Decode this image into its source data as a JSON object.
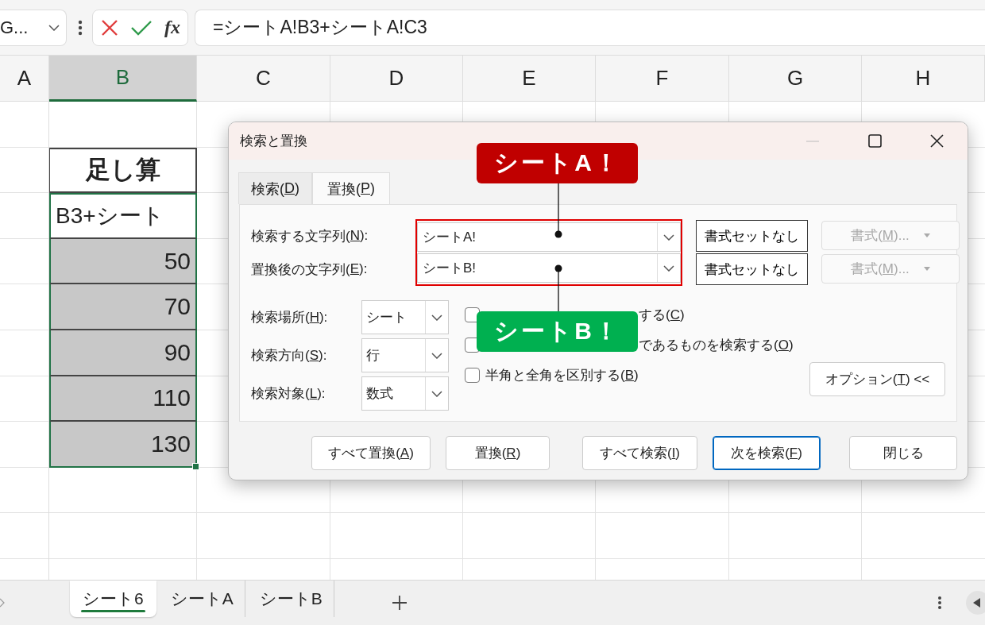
{
  "formula_bar": {
    "name_box": "G...",
    "function_label": "fx",
    "formula": "=シートA!B3+シートA!C3"
  },
  "sheet": {
    "columns": [
      {
        "label": "A",
        "selected": false
      },
      {
        "label": "B",
        "selected": true
      },
      {
        "label": "C",
        "selected": false
      },
      {
        "label": "D",
        "selected": false
      },
      {
        "label": "E",
        "selected": false
      },
      {
        "label": "F",
        "selected": false
      },
      {
        "label": "G",
        "selected": false
      },
      {
        "label": "H",
        "selected": false
      }
    ],
    "column_b_cells": [
      {
        "text": "足し算",
        "kind": "heading",
        "shaded": false,
        "selected": false
      },
      {
        "text": "B3+シート",
        "kind": "text",
        "shaded": false,
        "selected": true
      },
      {
        "text": "50",
        "kind": "number",
        "shaded": true,
        "selected": true
      },
      {
        "text": "70",
        "kind": "number",
        "shaded": true,
        "selected": true
      },
      {
        "text": "90",
        "kind": "number",
        "shaded": true,
        "selected": true
      },
      {
        "text": "110",
        "kind": "number",
        "shaded": true,
        "selected": true
      },
      {
        "text": "130",
        "kind": "number",
        "shaded": true,
        "selected": true
      }
    ]
  },
  "dialog": {
    "title": "検索と置換",
    "tabs": [
      {
        "label": {
          "pre": "検索(",
          "key": "D",
          "post": ")"
        },
        "selected": false
      },
      {
        "label": {
          "pre": "置換(",
          "key": "P",
          "post": ")"
        },
        "selected": true
      }
    ],
    "fields": [
      {
        "label": {
          "pre": "検索する文字列(",
          "key": "N",
          "post": "):"
        },
        "value": "シートA!",
        "format_reset": "書式セットなし",
        "format": {
          "label": {
            "pre": "書式(",
            "key": "M",
            "post": ")..."
          },
          "disabled": true
        }
      },
      {
        "label": {
          "pre": "置換後の文字列(",
          "key": "E",
          "post": "):"
        },
        "value": "シートB!",
        "format_reset": "書式セットなし",
        "format": {
          "label": {
            "pre": "書式(",
            "key": "M",
            "post": ")..."
          },
          "disabled": true
        }
      }
    ],
    "options": [
      {
        "label": {
          "pre": "検索場所(",
          "key": "H",
          "post": "):"
        },
        "value": "シート"
      },
      {
        "label": {
          "pre": "検索方向(",
          "key": "S",
          "post": "):"
        },
        "value": "行"
      },
      {
        "label": {
          "pre": "検索対象(",
          "key": "L",
          "post": "):"
        },
        "value": "数式"
      }
    ],
    "checkboxes": [
      {
        "label": {
          "pre": "する(",
          "key": "C",
          "post": ")"
        },
        "checked": false
      },
      {
        "label": {
          "pre": "であるものを検索する(",
          "key": "O",
          "post": ")"
        },
        "checked": false
      },
      {
        "label": {
          "pre": "半角と全角を区別する(",
          "key": "B",
          "post": ")"
        },
        "checked": false
      }
    ],
    "options_button": {
      "pre": "オプション(",
      "key": "T",
      "post": ") <<"
    },
    "buttons": [
      {
        "label": {
          "pre": "すべて置換(",
          "key": "A",
          "post": ")"
        },
        "focused": false
      },
      {
        "label": {
          "pre": "置換(",
          "key": "R",
          "post": ")"
        },
        "focused": false
      },
      {
        "label": {
          "pre": "すべて検索(",
          "key": "I",
          "post": ")"
        },
        "focused": false
      },
      {
        "label": {
          "pre": "次を検索(",
          "key": "F",
          "post": ")"
        },
        "focused": true
      },
      {
        "label": {
          "pre": "閉じる"
        },
        "focused": false
      }
    ]
  },
  "callouts": [
    {
      "text": "シートA！",
      "color": "#c00000"
    },
    {
      "text": "シートB！",
      "color": "#00b050"
    }
  ],
  "sheet_tabs": [
    {
      "label": "シート6",
      "selected": true
    },
    {
      "label": "シートA",
      "selected": false
    },
    {
      "label": "シートB",
      "selected": false
    }
  ]
}
